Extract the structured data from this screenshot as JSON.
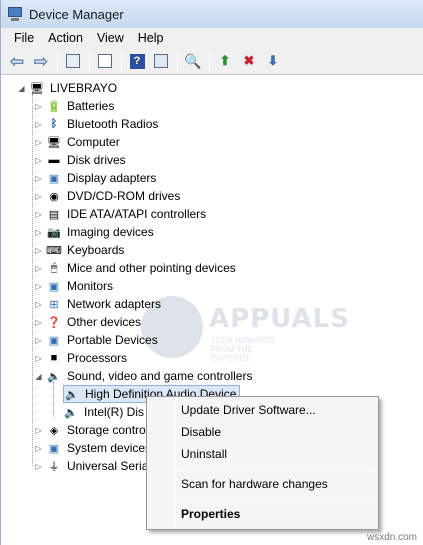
{
  "window": {
    "title": "Device Manager"
  },
  "menu": [
    "File",
    "Action",
    "View",
    "Help"
  ],
  "toolbar": {
    "buttons": [
      "back-arrow-icon",
      "forward-arrow-icon",
      "show-hide-console-tree-icon",
      "properties-icon",
      "help-icon",
      "action-pane-icon",
      "scan-hardware-icon",
      "update-driver-icon",
      "uninstall-icon",
      "disable-icon"
    ]
  },
  "tree": {
    "root": "LIVEBRAYO",
    "categories": [
      {
        "label": "Batteries",
        "icon": "battery-icon"
      },
      {
        "label": "Bluetooth Radios",
        "icon": "bluetooth-icon"
      },
      {
        "label": "Computer",
        "icon": "computer-icon"
      },
      {
        "label": "Disk drives",
        "icon": "disk-drive-icon"
      },
      {
        "label": "Display adapters",
        "icon": "display-adapter-icon"
      },
      {
        "label": "DVD/CD-ROM drives",
        "icon": "dvd-drive-icon"
      },
      {
        "label": "IDE ATA/ATAPI controllers",
        "icon": "ide-controller-icon"
      },
      {
        "label": "Imaging devices",
        "icon": "camera-icon"
      },
      {
        "label": "Keyboards",
        "icon": "keyboard-icon"
      },
      {
        "label": "Mice and other pointing devices",
        "icon": "mouse-icon"
      },
      {
        "label": "Monitors",
        "icon": "monitor-icon"
      },
      {
        "label": "Network adapters",
        "icon": "network-adapter-icon"
      },
      {
        "label": "Other devices",
        "icon": "unknown-device-icon"
      },
      {
        "label": "Portable Devices",
        "icon": "portable-device-icon"
      },
      {
        "label": "Processors",
        "icon": "processor-icon"
      },
      {
        "label": "Sound, video and game controllers",
        "icon": "speaker-icon"
      }
    ],
    "sound_children": [
      "High Definition Audio Device",
      "Intel(R) Dis"
    ],
    "after": [
      {
        "label": "Storage contro",
        "icon": "storage-controller-icon"
      },
      {
        "label": "System devices",
        "icon": "system-device-icon"
      },
      {
        "label": "Universal Seria",
        "icon": "usb-icon"
      }
    ]
  },
  "context_menu": {
    "update": "Update Driver Software...",
    "disable": "Disable",
    "uninstall": "Uninstall",
    "scan": "Scan for hardware changes",
    "properties": "Properties"
  },
  "watermark": {
    "brand": "APPUALS",
    "tagline": "TECH HOW-TO'S FROM THE EXPERTS!"
  },
  "footer": {
    "site": "wsxdn.com"
  }
}
